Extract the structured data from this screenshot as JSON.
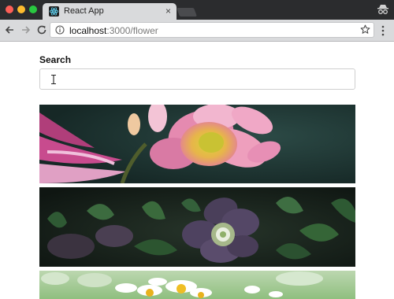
{
  "browser": {
    "tab_title": "React App",
    "tab_close": "×",
    "url_host": "localhost",
    "url_path": ":3000/flower",
    "icons": {
      "back": "arrow-left-icon",
      "forward": "arrow-right-icon",
      "reload": "reload-icon",
      "info": "info-icon",
      "bookmark": "star-icon",
      "menu": "kebab-menu-icon",
      "incognito": "incognito-icon",
      "favicon": "react-logo-icon"
    },
    "colors": {
      "close": "#fd5f57",
      "minimize": "#febc2e",
      "maximize": "#29c840"
    }
  },
  "page": {
    "search_label": "Search",
    "search_value": "",
    "photos": [
      {
        "subject": "pink and yellow dahlia flower"
      },
      {
        "subject": "dark purple hellebore flower among green leaves"
      },
      {
        "subject": "white daisies in a field"
      }
    ]
  }
}
